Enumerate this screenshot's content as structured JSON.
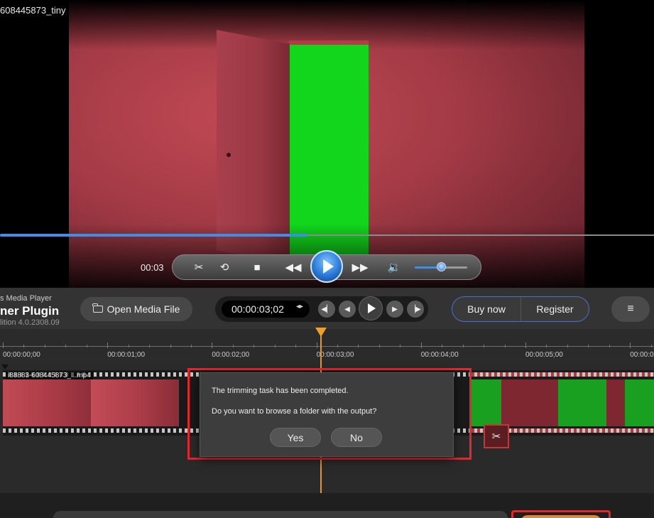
{
  "video": {
    "title": "608445873_tiny",
    "current_time": "00:03",
    "progress_fraction": 0.47,
    "volume_fraction": 0.45
  },
  "player_controls": {
    "buttons": [
      "switch-mode",
      "repeat",
      "stop",
      "rewind",
      "play",
      "fast-forward",
      "volume"
    ]
  },
  "plugin_bar": {
    "brand_line1": "s Media Player",
    "brand_line2": "ner Plugin",
    "brand_line3": "lition 4.0.2308.09",
    "open_media_label": "Open Media File",
    "timecode": "00:00:03;02",
    "timecode_spin": "◂▸",
    "buy_label": "Buy now",
    "register_label": "Register",
    "menu_glyph": "≡"
  },
  "timeline": {
    "ticks": [
      "00:00:00;00",
      "00:00:01;00",
      "00:00:02;00",
      "00:00:03;00",
      "00:00:04;00",
      "00:00:05;00",
      "00:00:0"
    ],
    "clip_name": "i88883-608445873_...mp4",
    "playhead_time": "00:00:03;00"
  },
  "dialog": {
    "message1": "The trimming task has been completed.",
    "message2": "Do you want to browse a folder with the output?",
    "yes_label": "Yes",
    "no_label": "No"
  },
  "colors": {
    "accent_blue": "#3d8ee8",
    "playhead": "#f0a020",
    "highlight_red": "#e5262e",
    "green_screen": "#12d61c"
  }
}
